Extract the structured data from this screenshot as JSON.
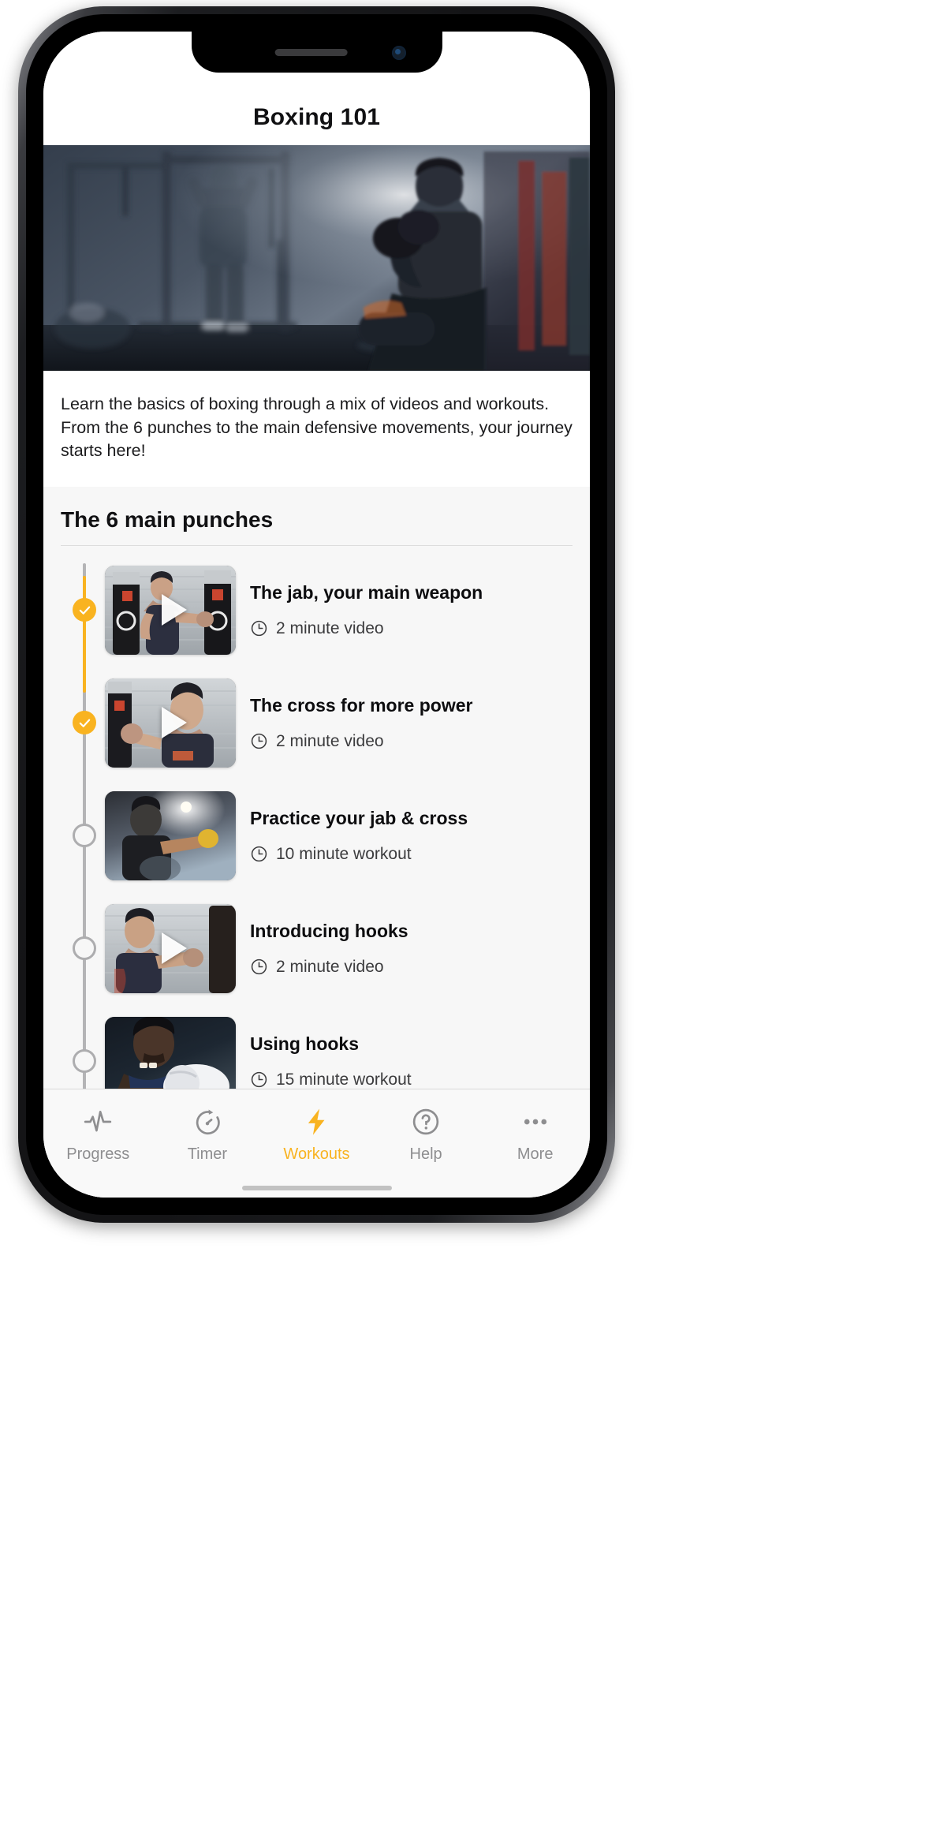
{
  "app": {
    "nav_title": "Boxing 101",
    "description": "Learn the basics of boxing through a mix of videos and workouts. From the 6 punches to the main defensive movements, your journey starts here!",
    "section_title": "The 6 main punches"
  },
  "colors": {
    "accent": "#f9b320",
    "track_inactive": "#b4b4b6",
    "text_primary": "#0d0d0f",
    "text_secondary": "#3c3c3e",
    "tab_inactive": "#8e8e90",
    "screen_bg": "#f7f7f7"
  },
  "lessons": [
    {
      "title": "The jab, your main weapon",
      "duration": "2 minute video",
      "type": "video",
      "status": "completed",
      "has_play": true
    },
    {
      "title": "The cross for more power",
      "duration": "2 minute video",
      "type": "video",
      "status": "completed",
      "has_play": true
    },
    {
      "title": "Practice your jab & cross",
      "duration": "10 minute workout",
      "type": "workout",
      "status": "incomplete",
      "has_play": false
    },
    {
      "title": "Introducing hooks",
      "duration": "2 minute video",
      "type": "video",
      "status": "incomplete",
      "has_play": true
    },
    {
      "title": "Using hooks",
      "duration": "15 minute workout",
      "type": "workout",
      "status": "incomplete",
      "has_play": false
    }
  ],
  "tabs": [
    {
      "label": "Progress",
      "icon": "activity-pulse-icon",
      "active": false
    },
    {
      "label": "Timer",
      "icon": "stopwatch-icon",
      "active": false
    },
    {
      "label": "Workouts",
      "icon": "lightning-bolt-icon",
      "active": true
    },
    {
      "label": "Help",
      "icon": "question-circle-icon",
      "active": false
    },
    {
      "label": "More",
      "icon": "ellipsis-icon",
      "active": false
    }
  ]
}
